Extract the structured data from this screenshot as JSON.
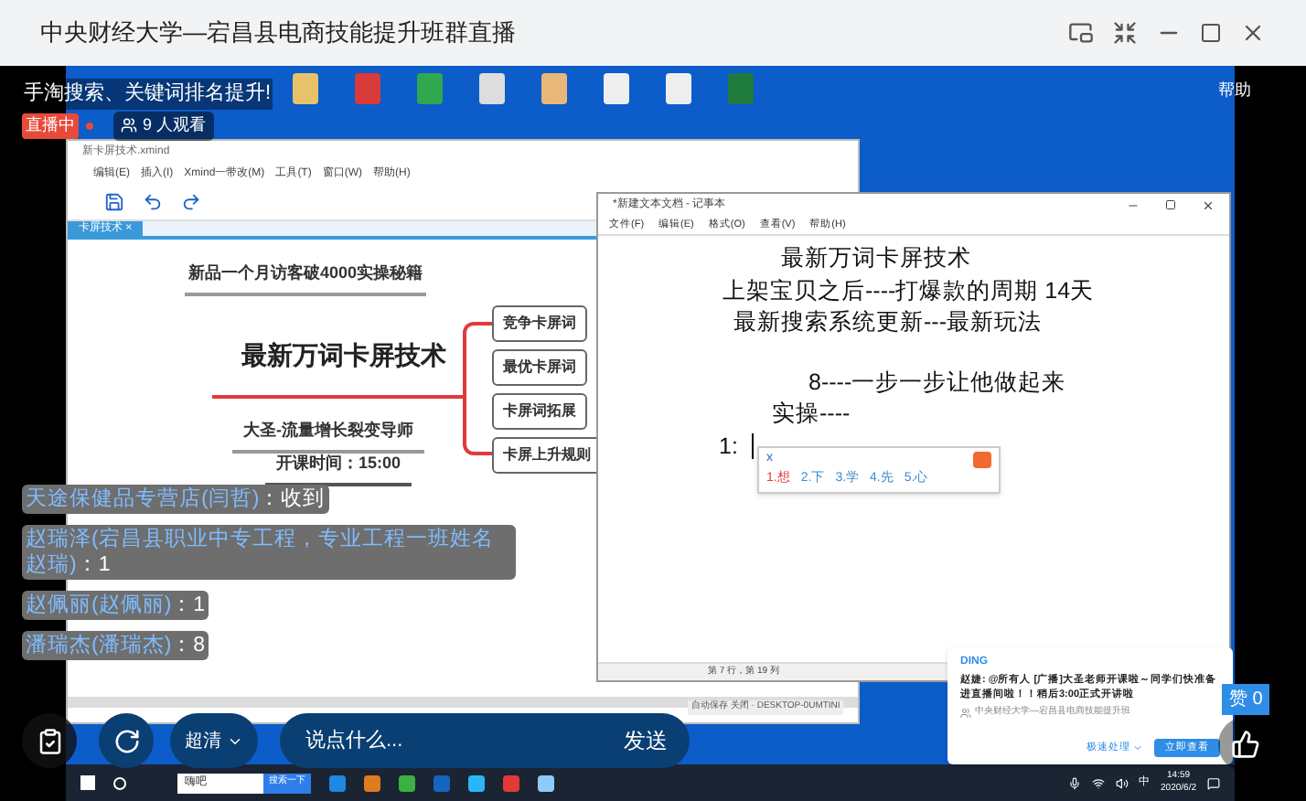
{
  "window": {
    "title": "中央财经大学—宕昌县电商技能提升班群直播"
  },
  "stream": {
    "headline": "手淘搜索、关键词排名提升!",
    "live_badge": "直播中",
    "viewers": "9 人观看",
    "help": "帮助"
  },
  "xmind": {
    "title": "新卡屏技术.xmind",
    "menu": [
      "编辑(E)",
      "插入(I)",
      "Xmind一带改(M)",
      "工具(T)",
      "窗口(W)",
      "帮助(H)"
    ],
    "tab": "卡屏技术 ×",
    "status": "自动保存 关闭 · DESKTOP-0UMTINI",
    "map": {
      "subtitle": "新品一个月访客破4000实操秘籍",
      "central": "最新万词卡屏技术",
      "speaker": "大圣-流量增长裂变导师",
      "time": "开课时间：15:00",
      "branches": [
        "竞争卡屏词",
        "最优卡屏词",
        "卡屏词拓展",
        "卡屏上升规则"
      ]
    }
  },
  "notepad": {
    "title": "*新建文本文档 - 记事本",
    "menu": [
      "文件(F)",
      "编辑(E)",
      "格式(O)",
      "查看(V)",
      "帮助(H)"
    ],
    "lines": [
      {
        "text": "最新万词卡屏技术"
      },
      {
        "text": "上架宝贝之后----打爆款的周期 14天"
      },
      {
        "text": "最新搜索系统更新---最新玩法"
      },
      {
        "text": "8----一步一步让他做起来"
      },
      {
        "text": "实操----"
      },
      {
        "text": "1:"
      }
    ],
    "ime": {
      "input": "x",
      "candidates": [
        {
          "text": "1.想",
          "selected": true
        },
        {
          "text": "2.下",
          "selected": false
        },
        {
          "text": "3.学",
          "selected": false
        },
        {
          "text": "4.先",
          "selected": false
        },
        {
          "text": "5.心",
          "selected": false
        }
      ]
    },
    "status": "第 7 行，第 19 列"
  },
  "notification": {
    "app": "DING",
    "message": "赵婕: @所有人 [广播]大圣老师开课啦～同学们快准备进直播间啦！！稍后3:00正式开讲啦",
    "group": "中央财经大学—宕昌县电商技能提升班",
    "secondary": "极速处理",
    "primary": "立即查看"
  },
  "taskbar": {
    "search": "嗨吧",
    "search_button": "搜索一下",
    "time": "14:59",
    "date": "2020/6/2",
    "ime": "中"
  },
  "chat": [
    {
      "name": "天途保健品专营店(闫哲)",
      "text": "：收到"
    },
    {
      "name": "赵瑞泽(宕昌县职业中专工程，专业工程一班姓名赵瑞)",
      "text": "：1"
    },
    {
      "name": "赵佩丽(赵佩丽)",
      "text": "：1"
    },
    {
      "name": "潘瑞杰(潘瑞杰)",
      "text": "：8"
    }
  ],
  "likes": "赞 0",
  "controls": {
    "quality": "超清",
    "placeholder": "说点什么...",
    "send": "发送"
  }
}
